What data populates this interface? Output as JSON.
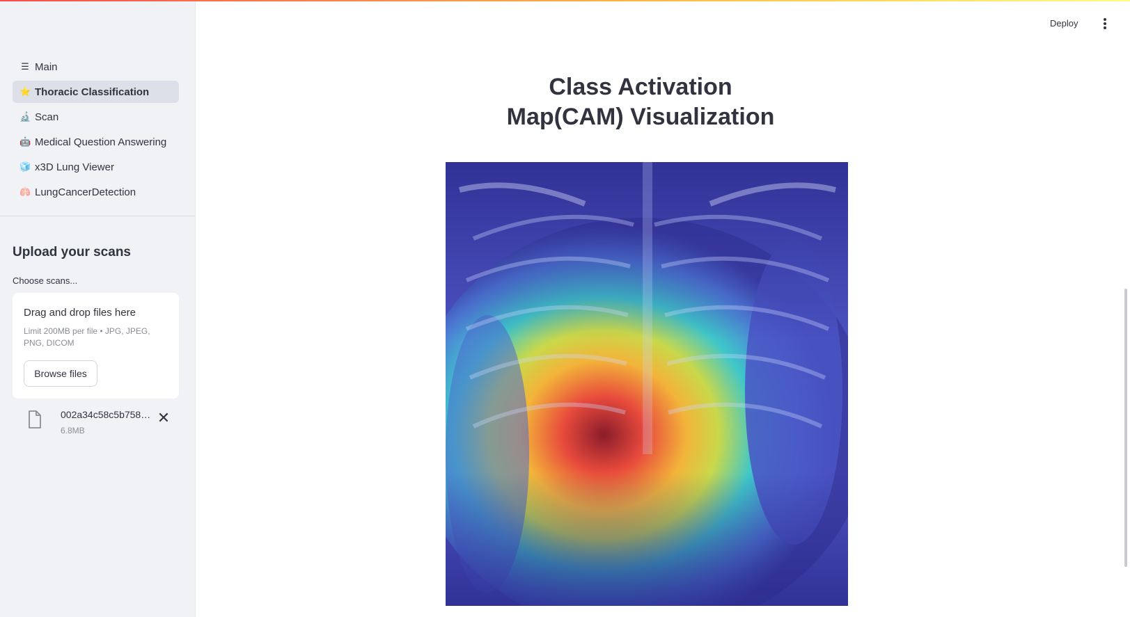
{
  "header": {
    "deploy_label": "Deploy",
    "menu_icon": "kebab-menu-icon"
  },
  "sidebar": {
    "nav_items": [
      {
        "label": "Main",
        "icon": "hamburger-icon",
        "glyph": "☰",
        "active": false
      },
      {
        "label": "Thoracic Classification",
        "icon": "star-icon",
        "glyph": "⭐",
        "active": true
      },
      {
        "label": "Scan",
        "icon": "microscope-icon",
        "glyph": "🔬",
        "active": false
      },
      {
        "label": "Medical Question Answering",
        "icon": "robot-icon",
        "glyph": "🤖",
        "active": false
      },
      {
        "label": "x3D Lung Viewer",
        "icon": "cube-icon",
        "glyph": "🧊",
        "active": false
      },
      {
        "label": "LungCancerDetection",
        "icon": "lungs-icon",
        "glyph": "🫁",
        "active": false
      }
    ],
    "upload": {
      "heading": "Upload your scans",
      "label": "Choose scans...",
      "dropzone_title": "Drag and drop files here",
      "dropzone_limit": "Limit 200MB per file • JPG, JPEG, PNG, DICOM",
      "browse_label": "Browse files",
      "file": {
        "name": "002a34c58c5b758…",
        "size": "6.8MB"
      }
    }
  },
  "main": {
    "title_line1": "Class Activation",
    "title_line2": "Map(CAM) Visualization",
    "image": "chest-xray-cam-heatmap"
  },
  "colors": {
    "sidebar_bg": "#f0f2f6",
    "active_item_bg": "#dde0e8",
    "text": "#31333f",
    "muted": "#8a8d97",
    "accent_start": "#ff4b4b"
  }
}
